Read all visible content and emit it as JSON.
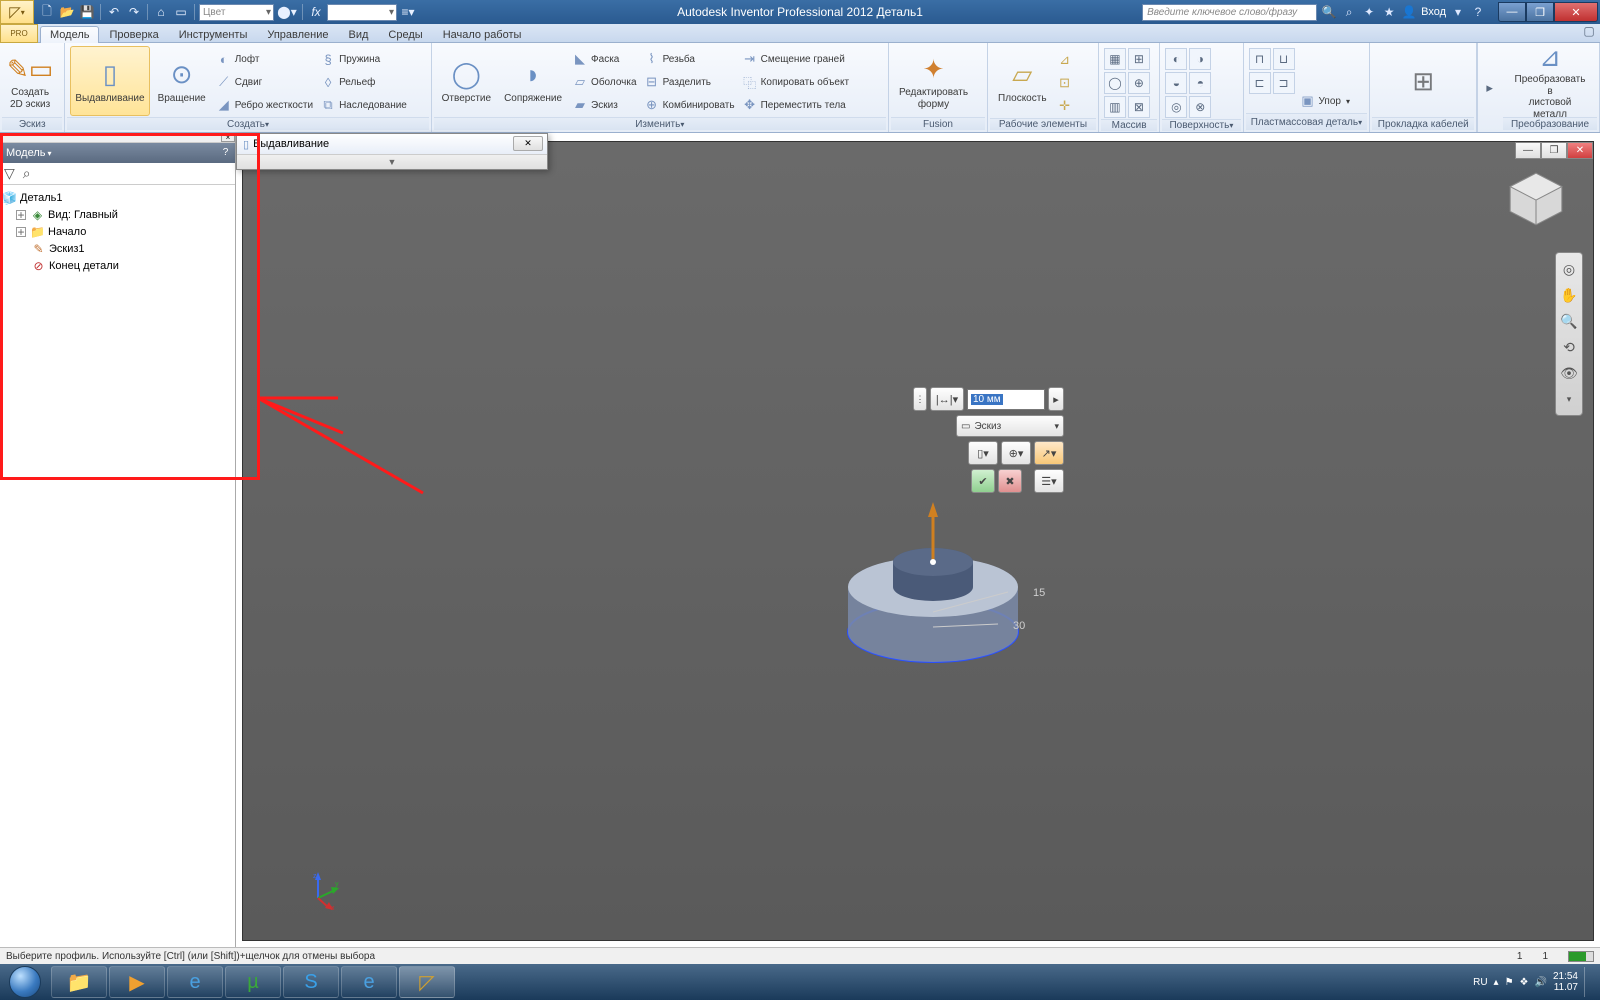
{
  "title": "Autodesk Inventor Professional 2012   Деталь1",
  "search_placeholder": "Введите ключевое слово/фразу",
  "login_label": "Вход",
  "qat_color": "Цвет",
  "pro_badge": "PRO",
  "tabs": [
    "Модель",
    "Проверка",
    "Инструменты",
    "Управление",
    "Вид",
    "Среды",
    "Начало работы"
  ],
  "panels": {
    "sketch": {
      "label": "Эскиз",
      "btn": "Создать\n2D эскиз"
    },
    "create": {
      "label": "Создать",
      "extrude": "Выдавливание",
      "revolve": "Вращение",
      "loft": "Лофт",
      "sweep": "Сдвиг",
      "rib": "Ребро жесткости",
      "coil": "Пружина",
      "emboss": "Рельеф",
      "derive": "Наследование"
    },
    "modify": {
      "label": "Изменить",
      "hole": "Отверстие",
      "fillet": "Сопряжение",
      "chamfer": "Фаска",
      "shell": "Оболочка",
      "draft": "Эскиз",
      "thread": "Резьба",
      "split": "Разделить",
      "combine": "Комбинировать",
      "offset": "Смещение граней",
      "copy": "Копировать объект",
      "move": "Переместить тела"
    },
    "fusion": {
      "label": "Fusion",
      "btn": "Редактировать\nформу"
    },
    "work": {
      "label": "Рабочие элементы",
      "btn": "Плоскость"
    },
    "pattern": {
      "label": "Массив"
    },
    "surface": {
      "label": "Поверхность"
    },
    "plastic": {
      "label": "Пластмассовая деталь",
      "thicken": "Упор"
    },
    "harness": {
      "label": "Прокладка кабелей"
    },
    "convert": {
      "label": "Преобразование",
      "btn": "Преобразовать в\nлистовой металл"
    }
  },
  "browser": {
    "title": "Модель",
    "root": "Деталь1",
    "nodes": [
      "Вид: Главный",
      "Начало",
      "Эскиз1",
      "Конец детали"
    ]
  },
  "float_dialog": {
    "title": "Выдавливание"
  },
  "hud": {
    "value": "10 мм",
    "profile": "Эскиз"
  },
  "dims": {
    "a": "15",
    "b": "30"
  },
  "status": {
    "msg": "Выберите профиль. Используйте [Ctrl] (или [Shift])+щелчок для отмены выбора",
    "n1": "1",
    "n2": "1"
  },
  "tray": {
    "lang": "RU",
    "time": "21:54",
    "date": "11.07"
  }
}
